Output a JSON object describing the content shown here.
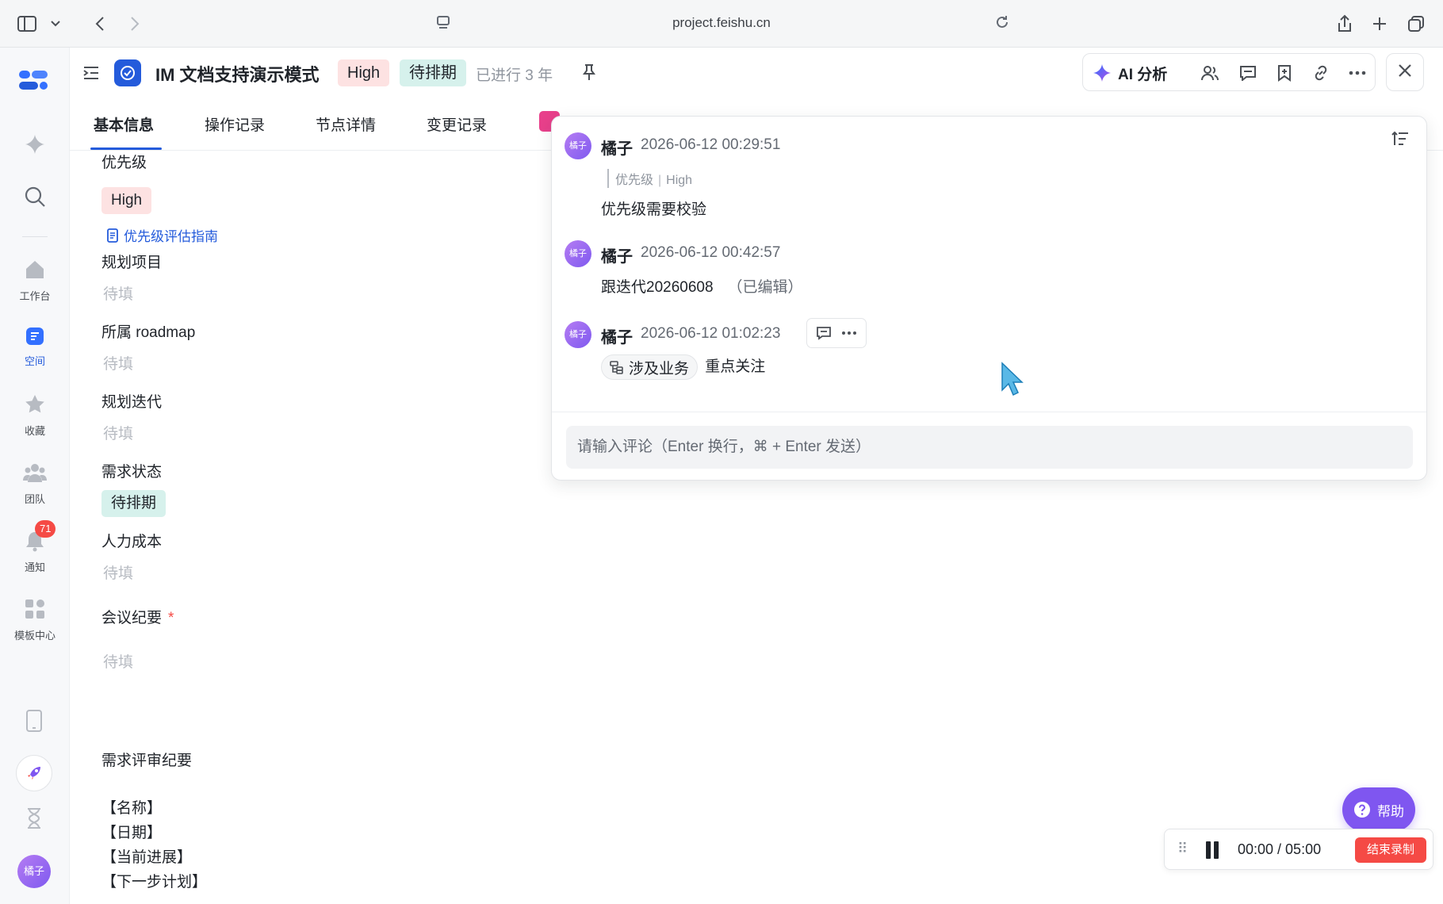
{
  "browser": {
    "url": "project.feishu.cn"
  },
  "nav": {
    "items": [
      {
        "label": "工作台"
      },
      {
        "label": "空间"
      },
      {
        "label": "收藏"
      },
      {
        "label": "团队"
      },
      {
        "label": "通知",
        "badge": "71"
      },
      {
        "label": "模板中心"
      }
    ],
    "user_avatar": "橘子"
  },
  "header": {
    "title": "IM 文档支持演示模式",
    "priority_tag": "High",
    "status_tag": "待排期",
    "elapsed": "已进行 3 年",
    "ai_label": "AI 分析"
  },
  "tabs": [
    "基本信息",
    "操作记录",
    "节点详情",
    "变更记录"
  ],
  "form": {
    "priority_label": "优先级",
    "priority_value": "High",
    "priority_guide": "优先级评估指南",
    "plan_project_label": "规划项目",
    "roadmap_label": "所属 roadmap",
    "iteration_label": "规划迭代",
    "status_label": "需求状态",
    "status_value": "待排期",
    "cost_label": "人力成本",
    "meeting_label": "会议纪要",
    "required_mark": "*",
    "empty": "待填",
    "review_title": "需求评审纪要",
    "review_lines": [
      "【名称】",
      "【日期】",
      "【当前进展】",
      "【下一步计划】"
    ]
  },
  "comments": [
    {
      "avatar": "橘子",
      "author": "橘子",
      "time": "2026-06-12 00:29:51",
      "quote_field": "优先级",
      "quote_value": "High",
      "body": "优先级需要校验"
    },
    {
      "avatar": "橘子",
      "author": "橘子",
      "time": "2026-06-12 00:42:57",
      "body": "跟迭代20260608",
      "edited": "（已编辑）"
    },
    {
      "avatar": "橘子",
      "author": "橘子",
      "time": "2026-06-12 01:02:23",
      "chip": "涉及业务",
      "body": "重点关注"
    }
  ],
  "comment_input": {
    "placeholder": "请输入评论（Enter 换行，⌘ + Enter 发送）"
  },
  "help": {
    "label": "帮助"
  },
  "recording": {
    "time": "00:00 / 05:00",
    "stop_label": "结束录制"
  },
  "colors": {
    "accent": "#245bdb",
    "high_tag": "#fde2e2",
    "status_tag": "#d6f1ec",
    "help": "#7f56f0",
    "stop": "#f54a45"
  }
}
